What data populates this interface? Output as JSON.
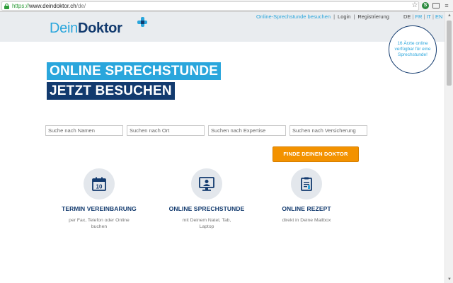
{
  "browser": {
    "url_proto": "https://",
    "url_host": "www.deindoktor.ch",
    "url_path": "/de/",
    "icons": [
      "star-icon",
      "extension-icon",
      "cast-icon",
      "menu-icon"
    ]
  },
  "header": {
    "logo_dein": "Dein",
    "logo_doktor": "Doktor",
    "nav": {
      "online": "Online-Sprechstunde besuchen",
      "sep1": "|",
      "login": "Login",
      "sep2": "|",
      "register": "Registrierung"
    },
    "langs": {
      "de": "DE",
      "sep1": "|",
      "fr": "FR",
      "sep2": "|",
      "it": "IT",
      "sep3": "|",
      "en": "EN"
    },
    "badge": "16 Ärzte online verfügbar für eine Sprechstunde!"
  },
  "hero": {
    "line1": "ONLINE SPRECHSTUNDE",
    "line2": "JETZT BESUCHEN"
  },
  "search": {
    "name_placeholder": "Suche nach Namen",
    "place_placeholder": "Suchen nach Ort",
    "expertise_placeholder": "Suchen nach Expertise",
    "insurance_placeholder": "Suchen nach Versicherung",
    "button": "FINDE DEINEN DOKTOR"
  },
  "features": [
    {
      "icon": "calendar-icon",
      "day": "10",
      "title": "TERMIN VEREINBARUNG",
      "desc": "per Fax, Telefon oder Online buchen"
    },
    {
      "icon": "monitor-doctor-icon",
      "title": "ONLINE SPRECHSTUNDE",
      "desc": "mit Deinem Natel, Tab, Laptop"
    },
    {
      "icon": "prescription-icon",
      "title": "ONLINE REZEPT",
      "desc": "direkt in Deine Mailbox"
    }
  ],
  "colors": {
    "brand_light": "#2aa6dc",
    "brand_dark": "#123a6e",
    "cta": "#f39200",
    "header_bg": "#e9ecef"
  }
}
